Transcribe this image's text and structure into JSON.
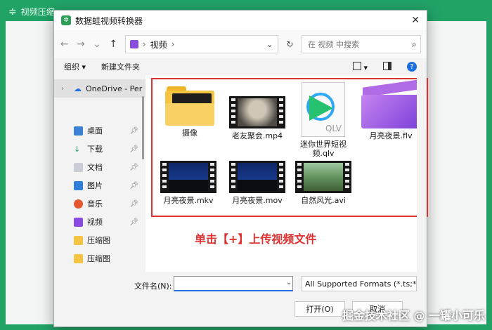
{
  "app": {
    "title": "视频压缩"
  },
  "dialog": {
    "title": "数据蛙视频转换器",
    "nav": {
      "address": {
        "segment": "视频",
        "separator": "›"
      },
      "search_placeholder": "在 视频 中搜索"
    },
    "toolbar": {
      "organize": "组织 ▾",
      "new_folder": "新建文件夹"
    },
    "sidebar": {
      "onedrive": "OneDrive - Per",
      "items": [
        {
          "label": "桌面",
          "icon": "desktop-icon"
        },
        {
          "label": "下载",
          "icon": "download-icon"
        },
        {
          "label": "文档",
          "icon": "document-icon"
        },
        {
          "label": "图片",
          "icon": "picture-icon"
        },
        {
          "label": "音乐",
          "icon": "music-icon"
        },
        {
          "label": "视频",
          "icon": "video-icon"
        },
        {
          "label": "压缩图",
          "icon": "folder-icon"
        },
        {
          "label": "压缩图",
          "icon": "folder-icon"
        }
      ]
    },
    "files": [
      {
        "name": "摄像",
        "kind": "folder"
      },
      {
        "name": "老友聚会.mp4",
        "kind": "video"
      },
      {
        "name": "迷你世界短视频.qlv",
        "kind": "qlv"
      },
      {
        "name": "月亮夜景.flv",
        "kind": "clapper"
      },
      {
        "name": "月亮夜景.mkv",
        "kind": "video"
      },
      {
        "name": "月亮夜景.mov",
        "kind": "video"
      },
      {
        "name": "自然风光.avi",
        "kind": "video"
      }
    ],
    "annotation": "单击【+】上传视频文件",
    "qlv_label": "QLV",
    "filename_label": "文件名(N):",
    "filename_value": "",
    "format": "All Supported Formats (*.ts;*",
    "open_button": "打开(O)",
    "cancel_button": "取消"
  },
  "watermark": "掘金技术社区 @ 一罐小可乐"
}
